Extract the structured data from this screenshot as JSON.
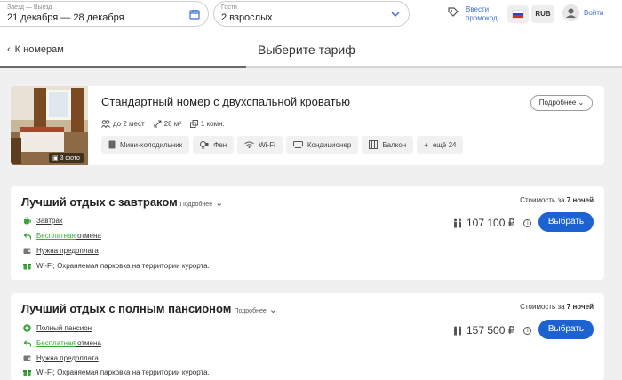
{
  "header": {
    "dates_caption": "Заезд — Выезд",
    "dates_value": "21 декабря — 28 декабря",
    "guests_caption": "Гости",
    "guests_value": "2 взрослых",
    "promo_line1": "Ввести",
    "promo_line2": "промокод",
    "currency": "RUB",
    "login": "Войти",
    "accent_color": "#3b6fd4"
  },
  "subheader": {
    "back_label": "К номерам",
    "title": "Выберите тариф"
  },
  "room": {
    "name": "Стандартный номер с двухспальной кроватью",
    "photo_count": "3 фото",
    "details_button": "Подробнее",
    "specs": [
      {
        "icon": "people-icon",
        "label": "до 2 мест"
      },
      {
        "icon": "area-icon",
        "label": "28 м²"
      },
      {
        "icon": "rooms-icon",
        "label": "1 комн."
      }
    ],
    "amenities": [
      {
        "icon": "fridge-icon",
        "label": "Мини-холодильник"
      },
      {
        "icon": "hairdryer-icon",
        "label": "Фен"
      },
      {
        "icon": "wifi-icon",
        "label": "Wi-Fi"
      },
      {
        "icon": "aircon-icon",
        "label": "Кондиционер"
      },
      {
        "icon": "balcony-icon",
        "label": "Балкон"
      },
      {
        "icon": "plus-icon",
        "label": "ещё 24"
      }
    ]
  },
  "tariffs": [
    {
      "title": "Лучший отдых с завтраком",
      "more": "Подробнее",
      "stay_prefix": "Стоимость за ",
      "stay_nights": "7 ночей",
      "meal": "Завтрак",
      "cancel_word": "Бесплатная",
      "cancel_rest": " отмена",
      "prepay": "Нужна предоплата",
      "extras": "Wi-Fi; Охраняемая парковка на территории курорта.",
      "price": "107 100 ₽",
      "button": "Выбрать"
    },
    {
      "title": "Лучший отдых с полным пансионом",
      "more": "Подробнее",
      "stay_prefix": "Стоимость за ",
      "stay_nights": "7 ночей",
      "meal": "Полный пансион",
      "cancel_word": "Бесплатная",
      "cancel_rest": " отмена",
      "prepay": "Нужна предоплата",
      "extras": "Wi-Fi; Охраняемая парковка на территории курорта.",
      "price": "157 500 ₽",
      "button": "Выбрать"
    }
  ],
  "colors": {
    "primary_button": "#1c63d1",
    "green": "#3aa33a"
  }
}
